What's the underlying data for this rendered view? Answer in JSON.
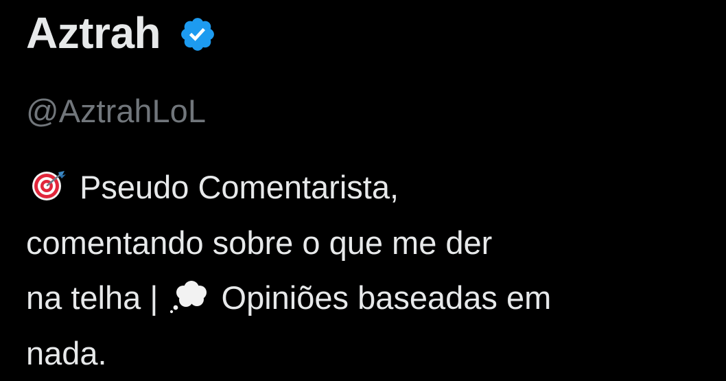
{
  "profile": {
    "display_name": "Aztrah",
    "verified_icon": "verified-badge-icon",
    "handle": "@AztrahLoL",
    "bio": {
      "line1_emoji": "direct-hit-target-icon",
      "line1_text": "Pseudo Comentarista,",
      "line2_text": "comentando sobre o que me der",
      "line3_text_before": "na telha |",
      "line3_emoji": "thought-balloon-icon",
      "line3_text_after": "Opiniões baseadas em",
      "line4_text": "nada."
    }
  },
  "colors": {
    "background": "#000000",
    "primary_text": "#e7e9ea",
    "secondary_text": "#71767b",
    "verified_blue": "#1d9bf0"
  }
}
